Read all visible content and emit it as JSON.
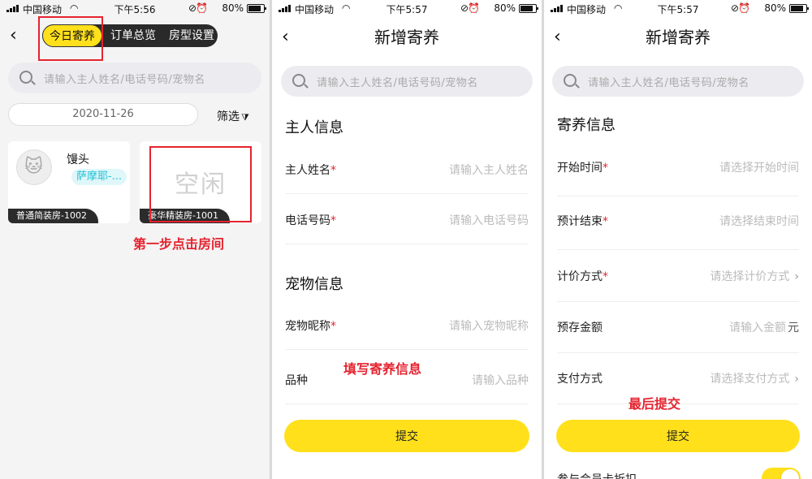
{
  "status": {
    "carrier": "中国移动",
    "battery": "80%",
    "panels_time": [
      "下午5:56",
      "下午5:57",
      "下午5:57"
    ]
  },
  "panel1": {
    "tabs": [
      "今日寄养",
      "订单总览",
      "房型设置"
    ],
    "search_placeholder": "请输入主人姓名/电话号码/宠物名",
    "date": "2020-11-26",
    "filter_label": "筛选",
    "rooms": [
      {
        "pet_name": "馒头",
        "breed": "萨摩耶-...",
        "room_label": "普通简装房-1002"
      },
      {
        "status": "空闲",
        "room_label": "豪华精装房-1001"
      }
    ],
    "annotation": "第一步点击房间"
  },
  "panel2": {
    "title": "新增寄养",
    "search_placeholder": "请输入主人姓名/电话号码/宠物名",
    "owner_section": "主人信息",
    "owner_name_label": "主人姓名",
    "owner_name_placeholder": "请输入主人姓名",
    "phone_label": "电话号码",
    "phone_placeholder": "请输入电话号码",
    "pet_section": "宠物信息",
    "pet_nick_label": "宠物昵称",
    "pet_nick_placeholder": "请输入宠物昵称",
    "breed_label": "品种",
    "breed_placeholder": "请输入品种",
    "annotation": "填写寄养信息",
    "submit": "提交"
  },
  "panel3": {
    "title": "新增寄养",
    "search_placeholder": "请输入主人姓名/电话号码/宠物名",
    "section": "寄养信息",
    "start_label": "开始时间",
    "start_placeholder": "请选择开始时间",
    "end_label": "预计结束",
    "end_placeholder": "请选择结束时间",
    "pricing_label": "计价方式",
    "pricing_placeholder": "请选择计价方式",
    "deposit_label": "预存金额",
    "deposit_placeholder": "请输入金额",
    "deposit_unit": "元",
    "payment_label": "支付方式",
    "payment_placeholder": "请选择支付方式",
    "annotation": "最后提交",
    "submit": "提交",
    "member_discount_label": "参与会员卡折扣",
    "member_discount_on": true
  },
  "colors": {
    "accent": "#ffe01b",
    "annotation": "#e5232f",
    "breed_tag": "#26c1d5"
  },
  "icons": {
    "back": "chevron-left-icon",
    "search": "search-icon",
    "filter": "filter-icon",
    "arrow": "chevron-right-icon"
  },
  "glyphs": {
    "back": "‹",
    "arrow": "›",
    "filter": "⧩",
    "required": "*",
    "wifi": "◠",
    "rotation_lock": "⊘",
    "alarm": "⏰"
  }
}
